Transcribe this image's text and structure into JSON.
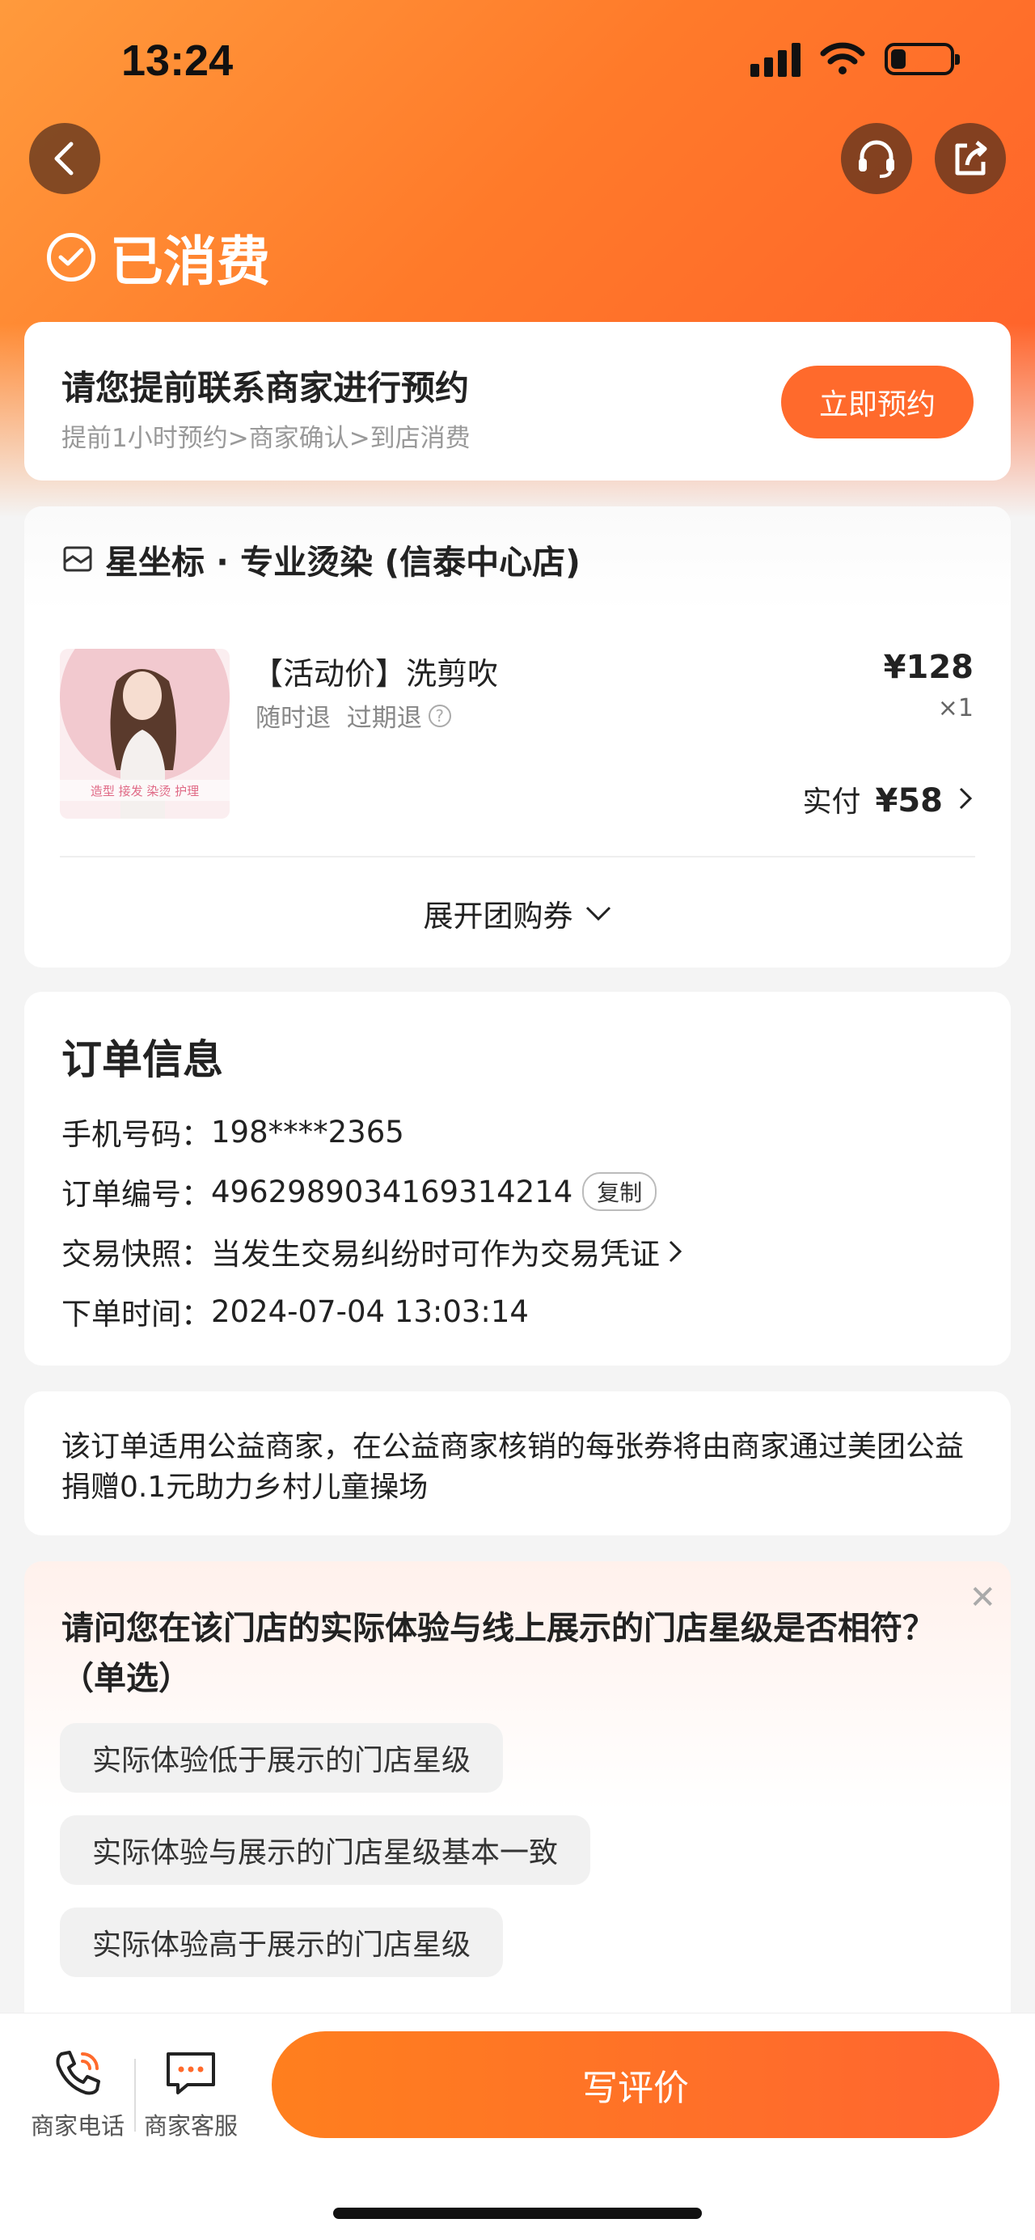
{
  "status_bar": {
    "time": "13:24"
  },
  "header": {
    "status_title": "已消费"
  },
  "booking": {
    "title": "请您提前联系商家进行预约",
    "steps": "提前1小时预约>商家确认>到店消费",
    "button": "立即预约"
  },
  "shop": {
    "name": "星坐标 · 专业烫染 (信泰中心店)",
    "product": {
      "title": "【活动价】洗剪吹",
      "tags": "随时退  过期退",
      "price": "¥128",
      "quantity": "×1",
      "paid_label": "实付",
      "paid_amount": "¥58",
      "image_strip_text": "造型  接发  染烫  护理"
    },
    "expand_label": "展开团购券"
  },
  "order": {
    "title": "订单信息",
    "phone_label": "手机号码：",
    "phone": "198****2365",
    "number_label": "订单编号：",
    "number": "4962989034169314214",
    "copy_label": "复制",
    "snapshot_label": "交易快照：",
    "snapshot_text": "当发生交易纠纷时可作为交易凭证",
    "time_label": "下单时间：",
    "time": "2024-07-04 13:03:14"
  },
  "charity": {
    "text": "该订单适用公益商家，在公益商家核销的每张券将由商家通过美团公益捐赠0.1元助力乡村儿童操场"
  },
  "survey": {
    "question": "请问您在该门店的实际体验与线上展示的门店星级是否相符？（单选）",
    "options": [
      "实际体验低于展示的门店星级",
      "实际体验与展示的门店星级基本一致",
      "实际体验高于展示的门店星级"
    ]
  },
  "bottom_bar": {
    "phone_label": "商家电话",
    "service_label": "商家客服",
    "review_button": "写评价"
  },
  "colors": {
    "accent": "#ff6a2c",
    "hero_start": "#ff9a3c",
    "hero_end": "#ff5e2b"
  }
}
